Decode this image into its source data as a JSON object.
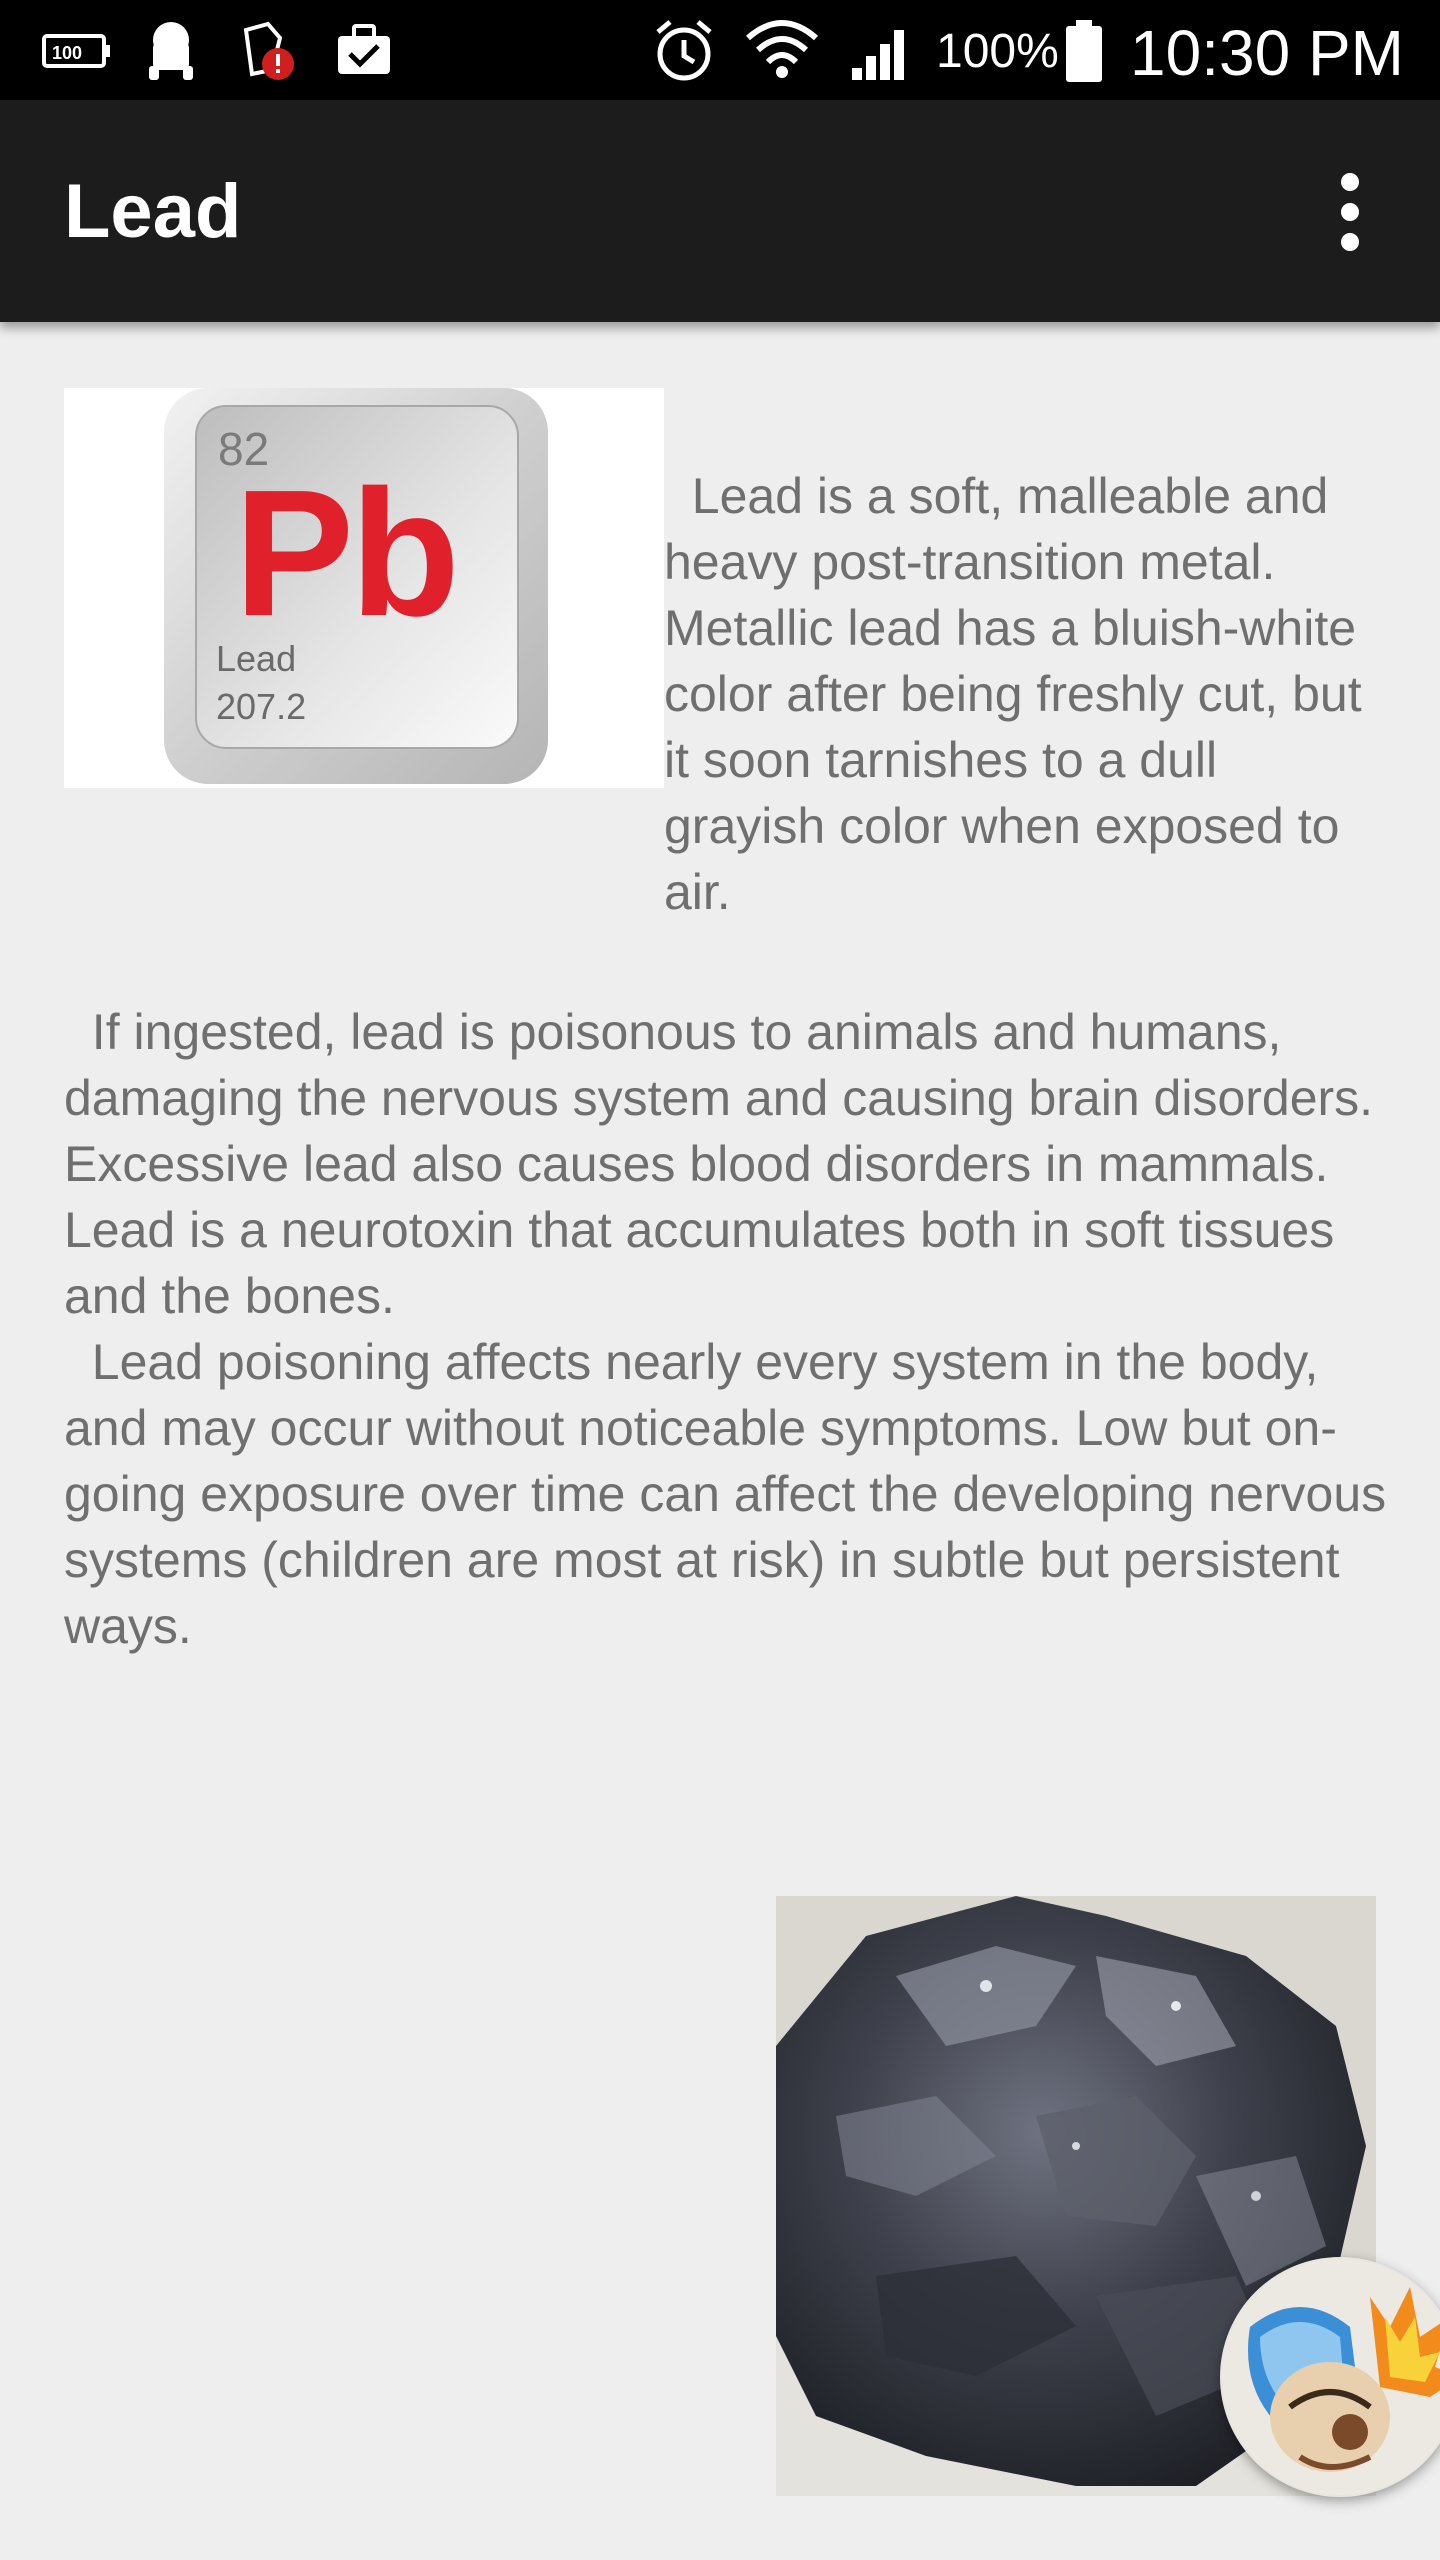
{
  "status_bar": {
    "battery_percent": "100%",
    "time": "10:30 PM",
    "icons": [
      "battery-100-icon",
      "android-icon",
      "app-alert-icon",
      "briefcase-check-icon",
      "alarm-icon",
      "wifi-icon",
      "signal-icon",
      "battery-icon"
    ]
  },
  "app_bar": {
    "title": "Lead",
    "overflow_icon": "more-vert-icon"
  },
  "element_tile": {
    "atomic_number": "82",
    "symbol": "Pb",
    "name": "Lead",
    "atomic_mass": "207.2"
  },
  "article": {
    "intro": "  Lead is a soft, malleable and heavy post-transition metal. Metallic lead has a bluish-white color after being freshly cut, but it soon tarnishes to a dull grayish color when exposed to air.",
    "body": "  If ingested, lead is poisonous to animals and humans, damaging the nervous system and causing brain disorders. Excessive lead also causes blood disorders in mammals. Lead is a neurotoxin that accumulates both in soft tissues and the bones.\n  Lead poisoning affects nearly every system in the body, and may occur without noticeable symptoms. Low but on-going exposure over time can affect the developing nervous systems (children are most at risk) in subtle but persistent ways."
  },
  "colors": {
    "status_bar_bg": "#000000",
    "app_bar_bg": "#1c1c1c",
    "page_bg": "#eeeeee",
    "text": "#6f6f6f",
    "symbol_red": "#e0202a"
  }
}
